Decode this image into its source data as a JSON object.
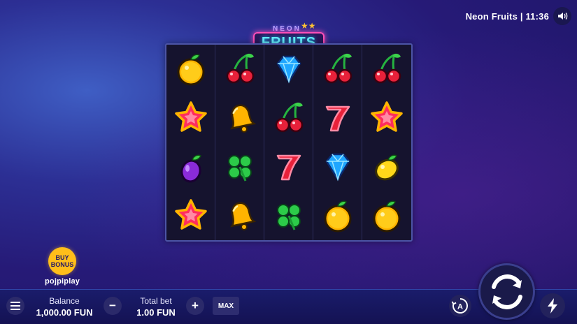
{
  "header": {
    "game_title": "Neon Fruits | 11:36",
    "sound_icon": "speaker-icon"
  },
  "logo": {
    "line1": "NEON",
    "line2": "FRUITS"
  },
  "reels": [
    [
      "orange",
      "star",
      "plum",
      "star"
    ],
    [
      "cherry",
      "bell",
      "clover",
      "bell"
    ],
    [
      "diamond",
      "cherry",
      "seven",
      "clover"
    ],
    [
      "cherry",
      "seven",
      "diamond",
      "orange"
    ],
    [
      "cherry",
      "star",
      "lemon",
      "orange"
    ]
  ],
  "buy_bonus": {
    "line1": "BUY",
    "line2": "BONUS"
  },
  "brand": "pojpiplay",
  "bottom": {
    "menu_icon": "menu-icon",
    "balance_label": "Balance",
    "balance_value": "1,000.00 FUN",
    "total_bet_label": "Total bet",
    "total_bet_value": "1.00 FUN",
    "minus_label": "−",
    "plus_label": "+",
    "max_label": "MAX",
    "auto_label": "A"
  },
  "colors": {
    "accent_yellow": "#ffbe1a",
    "neon_pink": "#ff4fb8",
    "neon_cyan": "#64f0ff"
  }
}
